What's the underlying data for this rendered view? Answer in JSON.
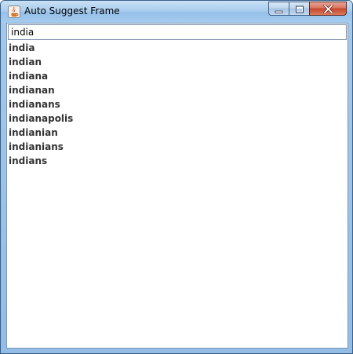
{
  "window": {
    "title": "Auto Suggest Frame",
    "icon": "java-cup-icon",
    "controls": [
      "minimize-icon",
      "maximize-icon",
      "close-icon"
    ]
  },
  "search": {
    "value": "india"
  },
  "suggestions": [
    "india",
    "indian",
    "indiana",
    "indianan",
    "indianans",
    "indianapolis",
    "indianian",
    "indianians",
    "indians"
  ],
  "colors": {
    "title_bar": "#a6cbee",
    "close_button": "#c6452d",
    "window_border": "#3a5f88"
  }
}
